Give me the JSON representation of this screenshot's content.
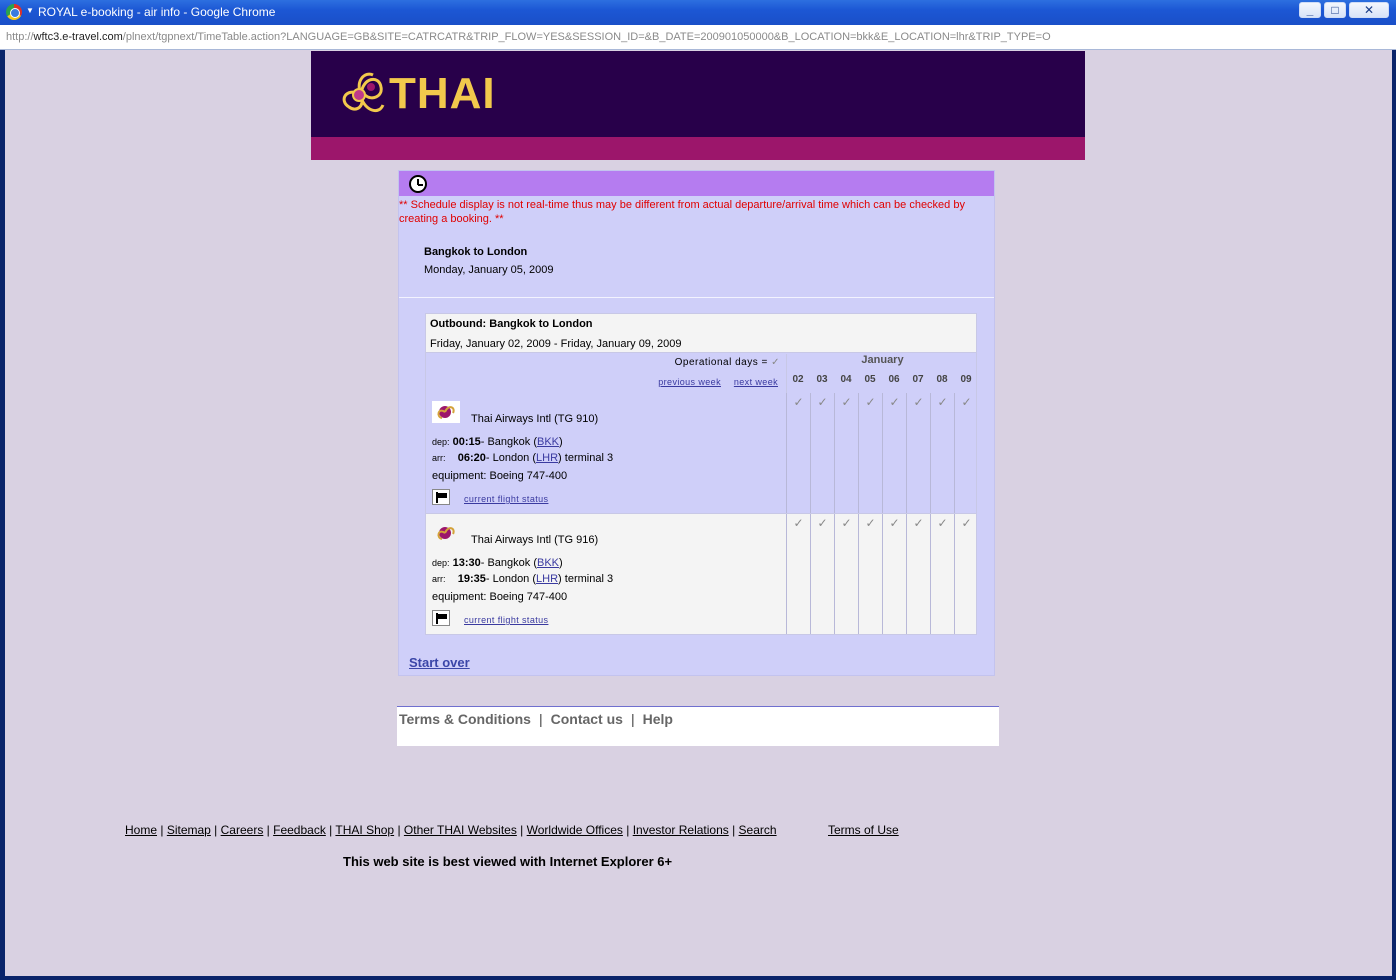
{
  "window": {
    "title": "ROYAL e-booking - air info - Google Chrome",
    "url_host": "wftc3.e-travel.com",
    "url_path": "/plnext/tgpnext/TimeTable.action?LANGUAGE=GB&SITE=CATRCATR&TRIP_FLOW=YES&SESSION_ID=&B_DATE=200901050000&B_LOCATION=bkk&E_LOCATION=lhr&TRIP_TYPE=O",
    "url_scheme": "http://"
  },
  "brand": {
    "logo_text": "THAI"
  },
  "schedule": {
    "notice": "** Schedule display is not real-time thus may be different from actual departure/arrival time which can be checked by creating a booking. **",
    "route_title": "Bangkok to London",
    "route_date": "Monday, January 05, 2009",
    "outbound_title": "Outbound: Bangkok to London",
    "outbound_range": "Friday, January 02, 2009 - Friday, January 09, 2009",
    "operational_days_label": "Operational days =",
    "check_mark": "✓",
    "previous_week": "previous week",
    "next_week": "next week",
    "month": "January",
    "days": [
      "02",
      "03",
      "04",
      "05",
      "06",
      "07",
      "08",
      "09"
    ],
    "flights": [
      {
        "airline": "Thai Airways Intl (TG 910)",
        "dep_label": "dep:",
        "dep_time": "00:15",
        "dep_city": "- Bangkok (",
        "dep_code": "BKK",
        "arr_label": "arr:",
        "arr_time": "06:20",
        "arr_city": "- London (",
        "arr_code": "LHR",
        "arr_terminal": ") terminal 3",
        "equipment": "equipment: Boeing 747-400",
        "status_link": "current flight status"
      },
      {
        "airline": "Thai Airways Intl (TG 916)",
        "dep_label": "dep:",
        "dep_time": "13:30",
        "dep_city": "- Bangkok (",
        "dep_code": "BKK",
        "arr_label": "arr:",
        "arr_time": "19:35",
        "arr_city": "- London (",
        "arr_code": "LHR",
        "arr_terminal": ") terminal 3",
        "equipment": "equipment: Boeing 747-400",
        "status_link": "current flight status"
      }
    ],
    "start_over": "Start over"
  },
  "footer": {
    "terms_conditions": "Terms & Conditions",
    "contact_us": "Contact us",
    "help": "Help",
    "sep": "|",
    "site_links": [
      "Home",
      "Sitemap",
      "Careers",
      "Feedback",
      "THAI Shop",
      "Other THAI Websites",
      "Worldwide Offices",
      "Investor Relations",
      "Search"
    ],
    "terms_of_use": "Terms of Use",
    "best_viewed": "This web site is best viewed with Internet Explorer 6+"
  }
}
